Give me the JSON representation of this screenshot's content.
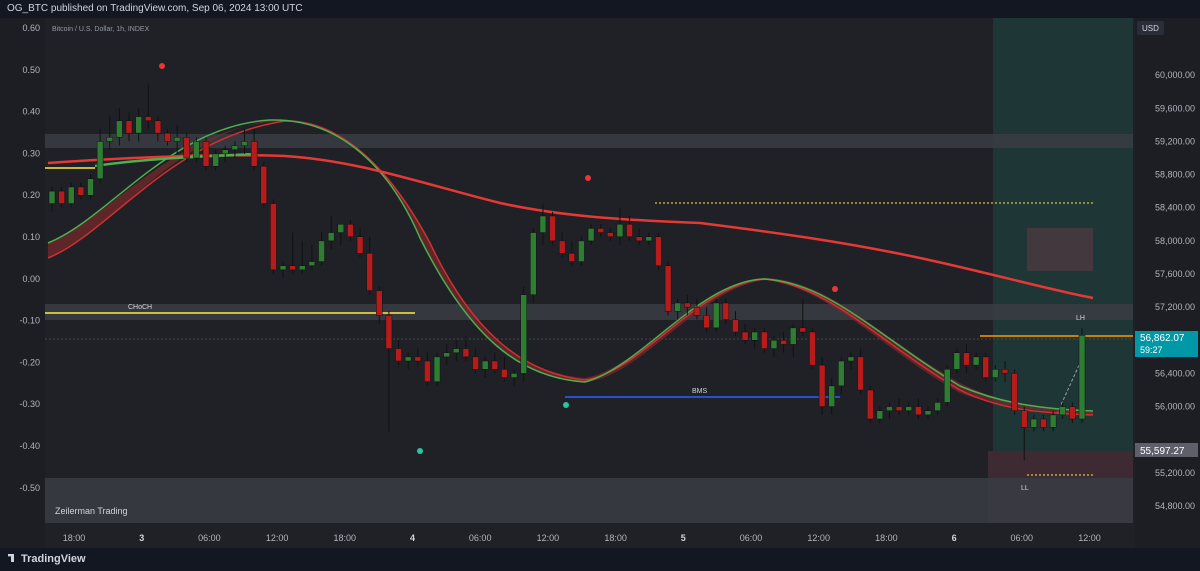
{
  "header": {
    "published": "OG_BTC published on TradingView.com, Sep 06, 2024 13:00 UTC"
  },
  "footer": {
    "brand": "TradingView"
  },
  "chart_data": {
    "type": "candlestick",
    "symbol": "Bitcoin / U.S. Dollar, 1h, INDEX",
    "currency": "USD",
    "watermark": "Zeilerman Trading",
    "left_axis": {
      "ticks": [
        "0.60",
        "0.50",
        "0.40",
        "0.30",
        "0.20",
        "0.10",
        "0.00",
        "-0.10",
        "-0.20",
        "-0.30",
        "-0.40",
        "-0.50"
      ]
    },
    "right_axis": {
      "ylim": [
        54800,
        60400
      ],
      "ticks": [
        "60,000.00",
        "59,600.00",
        "59,200.00",
        "58,800.00",
        "58,400.00",
        "58,000.00",
        "57,600.00",
        "57,200.00",
        "56,400.00",
        "56,000.00",
        "55,200.00",
        "54,800.00"
      ]
    },
    "x_ticks": [
      "18:00",
      "3",
      "06:00",
      "12:00",
      "18:00",
      "4",
      "06:00",
      "12:00",
      "18:00",
      "5",
      "06:00",
      "12:00",
      "18:00",
      "6",
      "06:00",
      "12:00"
    ],
    "current_price": "56,862.07",
    "countdown": "59:27",
    "grey_price": "55,597.27",
    "annotations": {
      "choch": "CHoCH",
      "bms": "BMS",
      "lh": "LH",
      "ll": "LL"
    },
    "candles": [
      [
        58450,
        58650,
        58350,
        58600
      ],
      [
        58600,
        58650,
        58400,
        58450
      ],
      [
        58450,
        58700,
        58400,
        58650
      ],
      [
        58650,
        58700,
        58500,
        58550
      ],
      [
        58550,
        58800,
        58500,
        58750
      ],
      [
        58750,
        59350,
        58700,
        59200
      ],
      [
        59200,
        59500,
        59100,
        59250
      ],
      [
        59250,
        59600,
        59150,
        59450
      ],
      [
        59450,
        59550,
        59200,
        59300
      ],
      [
        59300,
        59600,
        59200,
        59500
      ],
      [
        59500,
        59900,
        59350,
        59450
      ],
      [
        59450,
        59500,
        59200,
        59300
      ],
      [
        59300,
        59350,
        59150,
        59200
      ],
      [
        59200,
        59400,
        59050,
        59250
      ],
      [
        59250,
        59300,
        58950,
        59000
      ],
      [
        59000,
        59250,
        58950,
        59200
      ],
      [
        59200,
        59250,
        58850,
        58900
      ],
      [
        58900,
        59100,
        58850,
        59050
      ],
      [
        59050,
        59150,
        58950,
        59100
      ],
      [
        59100,
        59200,
        59000,
        59150
      ],
      [
        59150,
        59350,
        59050,
        59200
      ],
      [
        59200,
        59350,
        58850,
        58900
      ],
      [
        58900,
        58950,
        58400,
        58450
      ],
      [
        58450,
        58500,
        57600,
        57650
      ],
      [
        57650,
        57750,
        57550,
        57700
      ],
      [
        57700,
        58100,
        57600,
        57650
      ],
      [
        57650,
        58000,
        57600,
        57700
      ],
      [
        57700,
        57950,
        57650,
        57750
      ],
      [
        57750,
        58100,
        57700,
        58000
      ],
      [
        58000,
        58300,
        57900,
        58100
      ],
      [
        58100,
        58200,
        57950,
        58200
      ],
      [
        58200,
        58250,
        58000,
        58050
      ],
      [
        58050,
        58150,
        57800,
        57850
      ],
      [
        57850,
        58050,
        57350,
        57400
      ],
      [
        57400,
        57450,
        57000,
        57100
      ],
      [
        57100,
        57150,
        55700,
        56700
      ],
      [
        56700,
        56800,
        56500,
        56550
      ],
      [
        56550,
        56650,
        56450,
        56600
      ],
      [
        56600,
        56700,
        56500,
        56550
      ],
      [
        56550,
        56650,
        56250,
        56300
      ],
      [
        56300,
        56650,
        56250,
        56600
      ],
      [
        56600,
        56750,
        56500,
        56650
      ],
      [
        56650,
        56800,
        56550,
        56700
      ],
      [
        56700,
        56850,
        56550,
        56600
      ],
      [
        56600,
        56700,
        56400,
        56450
      ],
      [
        56450,
        56600,
        56350,
        56550
      ],
      [
        56550,
        56650,
        56400,
        56450
      ],
      [
        56450,
        56600,
        56300,
        56350
      ],
      [
        56350,
        56450,
        56250,
        56400
      ],
      [
        56400,
        57450,
        56300,
        57350
      ],
      [
        57350,
        58150,
        57250,
        58100
      ],
      [
        58100,
        58450,
        57950,
        58300
      ],
      [
        58300,
        58350,
        57950,
        58000
      ],
      [
        58000,
        58100,
        57800,
        57850
      ],
      [
        57850,
        58000,
        57700,
        57750
      ],
      [
        57750,
        58050,
        57700,
        58000
      ],
      [
        58000,
        58200,
        57950,
        58150
      ],
      [
        58150,
        58200,
        58050,
        58100
      ],
      [
        58100,
        58150,
        58000,
        58050
      ],
      [
        58050,
        58400,
        57950,
        58200
      ],
      [
        58200,
        58300,
        58000,
        58050
      ],
      [
        58050,
        58150,
        57950,
        58000
      ],
      [
        58000,
        58100,
        57950,
        58050
      ],
      [
        58050,
        58100,
        57650,
        57700
      ],
      [
        57700,
        57750,
        57100,
        57150
      ],
      [
        57150,
        57300,
        57050,
        57250
      ],
      [
        57250,
        57350,
        57100,
        57200
      ],
      [
        57200,
        57300,
        57050,
        57100
      ],
      [
        57100,
        57200,
        56900,
        56950
      ],
      [
        56950,
        57300,
        56900,
        57250
      ],
      [
        57250,
        57300,
        57000,
        57050
      ],
      [
        57050,
        57150,
        56850,
        56900
      ],
      [
        56900,
        57000,
        56750,
        56800
      ],
      [
        56800,
        56950,
        56700,
        56900
      ],
      [
        56900,
        56950,
        56650,
        56700
      ],
      [
        56700,
        56850,
        56600,
        56800
      ],
      [
        56800,
        56900,
        56650,
        56750
      ],
      [
        56750,
        57000,
        56600,
        56950
      ],
      [
        56950,
        57300,
        56850,
        56900
      ],
      [
        56900,
        56950,
        56450,
        56500
      ],
      [
        56500,
        56600,
        55900,
        56000
      ],
      [
        56000,
        56350,
        55900,
        56250
      ],
      [
        56250,
        56600,
        56150,
        56550
      ],
      [
        56550,
        56650,
        56450,
        56600
      ],
      [
        56600,
        56700,
        56150,
        56200
      ],
      [
        56200,
        56250,
        55800,
        55850
      ],
      [
        55850,
        56000,
        55800,
        55950
      ],
      [
        55950,
        56050,
        55850,
        56000
      ],
      [
        56000,
        56100,
        55900,
        55950
      ],
      [
        55950,
        56050,
        55900,
        56000
      ],
      [
        56000,
        56100,
        55850,
        55900
      ],
      [
        55900,
        56000,
        55850,
        55950
      ],
      [
        55950,
        56100,
        55900,
        56050
      ],
      [
        56050,
        56500,
        56000,
        56450
      ],
      [
        56450,
        56700,
        56400,
        56650
      ],
      [
        56650,
        56750,
        56400,
        56500
      ],
      [
        56500,
        56650,
        56450,
        56600
      ],
      [
        56600,
        56650,
        56300,
        56350
      ],
      [
        56350,
        56500,
        56300,
        56450
      ],
      [
        56450,
        56550,
        56300,
        56400
      ],
      [
        56400,
        56450,
        55900,
        55950
      ],
      [
        55950,
        56000,
        55350,
        55750
      ],
      [
        55750,
        55900,
        55700,
        55850
      ],
      [
        55850,
        55900,
        55700,
        55750
      ],
      [
        55750,
        55950,
        55700,
        55900
      ],
      [
        55900,
        56050,
        55850,
        56000
      ],
      [
        56000,
        56050,
        55800,
        55850
      ],
      [
        55850,
        56950,
        55800,
        56860
      ]
    ]
  }
}
